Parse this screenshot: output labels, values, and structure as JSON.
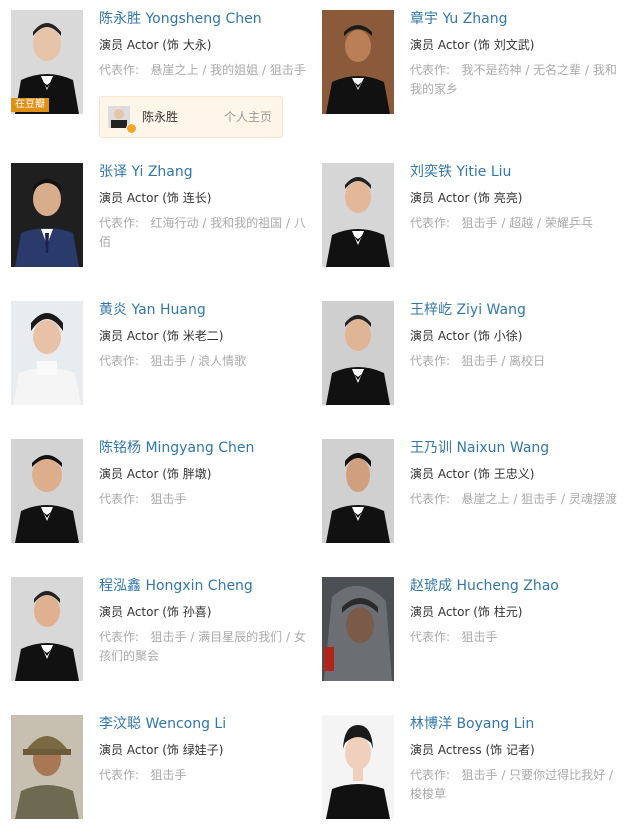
{
  "people": [
    {
      "name": "陈永胜 Yongsheng Chen",
      "role": "演员 Actor (饰 大永)",
      "works_label": "代表作:",
      "works": "悬崖之上 / 我的姐姐 / 狙击手"
    },
    {
      "name": "章宇 Yu Zhang",
      "role": "演员 Actor (饰 刘文武)",
      "works_label": "代表作:",
      "works": "我不是药神 / 无名之辈 / 我和我的家乡"
    },
    {
      "name": "张译 Yi Zhang",
      "role": "演员 Actor (饰 连长)",
      "works_label": "代表作:",
      "works": "红海行动 / 我和我的祖国 / 八佰"
    },
    {
      "name": "刘奕铁 Yitie Liu",
      "role": "演员 Actor (饰 亮亮)",
      "works_label": "代表作:",
      "works": "狙击手 / 超越 / 荣耀乒乓"
    },
    {
      "name": "黄炎 Yan Huang",
      "role": "演员 Actor (饰 米老二)",
      "works_label": "代表作:",
      "works": "狙击手 / 浪人情歌"
    },
    {
      "name": "王梓屹 Ziyi Wang",
      "role": "演员 Actor (饰 小徐)",
      "works_label": "代表作:",
      "works": "狙击手 / 离校日"
    },
    {
      "name": "陈铭杨 Mingyang Chen",
      "role": "演员 Actor (饰 胖墩)",
      "works_label": "代表作:",
      "works": "狙击手"
    },
    {
      "name": "王乃训 Naixun Wang",
      "role": "演员 Actor (饰 王忠义)",
      "works_label": "代表作:",
      "works": "悬崖之上 / 狙击手 / 灵魂摆渡"
    },
    {
      "name": "程泓鑫 Hongxin Cheng",
      "role": "演员 Actor (饰 孙喜)",
      "works_label": "代表作:",
      "works": "狙击手 / 满目星辰的我们 / 女孩们的聚会"
    },
    {
      "name": "赵琥成 Hucheng Zhao",
      "role": "演员 Actor (饰 柱元)",
      "works_label": "代表作:",
      "works": "狙击手"
    },
    {
      "name": "李汶聪 Wencong Li",
      "role": "演员 Actor (饰 绿娃子)",
      "works_label": "代表作:",
      "works": "狙击手"
    },
    {
      "name": "林博洋 Boyang Lin",
      "role": "演员 Actress (饰 记者)",
      "works_label": "代表作:",
      "works": "狙击手 / 只要你过得比我好 / 梭梭草"
    }
  ],
  "badge": "在豆瓣",
  "homepage": {
    "name": "陈永胜",
    "link": "个人主页"
  },
  "colors": {
    "name_link": "#3377aa",
    "badge": "#e09015",
    "homepage_bg": "#fff5e9"
  }
}
